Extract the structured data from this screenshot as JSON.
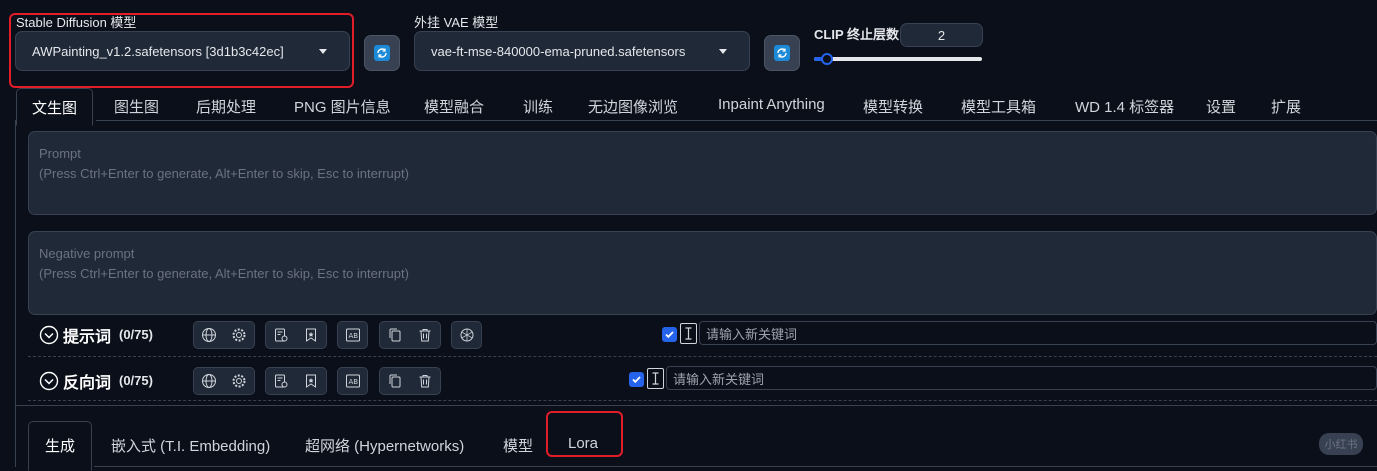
{
  "models": {
    "sd_label": "Stable Diffusion 模型",
    "sd_value": "AWPainting_v1.2.safetensors [3d1b3c42ec]",
    "vae_label": "外挂 VAE 模型",
    "vae_value": "vae-ft-mse-840000-ema-pruned.safetensors",
    "clip_label": "CLIP 终止层数",
    "clip_value": "2",
    "clip_fraction": 0.08
  },
  "tabs": [
    {
      "label": "文生图",
      "active": true
    },
    {
      "label": "图生图"
    },
    {
      "label": "后期处理"
    },
    {
      "label": "PNG 图片信息"
    },
    {
      "label": "模型融合"
    },
    {
      "label": "训练"
    },
    {
      "label": "无边图像浏览"
    },
    {
      "label": "Inpaint Anything"
    },
    {
      "label": "模型转换"
    },
    {
      "label": "模型工具箱"
    },
    {
      "label": "WD 1.4 标签器"
    },
    {
      "label": "设置"
    },
    {
      "label": "扩展"
    }
  ],
  "prompt": {
    "placeholder_title": "Prompt",
    "placeholder_hint": "(Press Ctrl+Enter to generate, Alt+Enter to skip, Esc to interrupt)"
  },
  "negative_prompt": {
    "placeholder_title": "Negative prompt",
    "placeholder_hint": "(Press Ctrl+Enter to generate, Alt+Enter to skip, Esc to interrupt)"
  },
  "prompt_toolbar": {
    "label": "提示词",
    "count": "(0/75)",
    "keyword_placeholder": "请输入新关键词"
  },
  "negative_toolbar": {
    "label": "反向词",
    "count": "(0/75)",
    "keyword_placeholder": "请输入新关键词"
  },
  "subtabs": [
    {
      "label": "生成",
      "active": true
    },
    {
      "label": "嵌入式 (T.I. Embedding)"
    },
    {
      "label": "超网络 (Hypernetworks)"
    },
    {
      "label": "模型"
    },
    {
      "label": "Lora"
    }
  ],
  "watermark": "小红书",
  "colors": {
    "background": "#0b0f19",
    "panel": "#1f2937",
    "border": "#374151",
    "accent": "#2563eb",
    "highlight_box": "#e11d2a"
  }
}
